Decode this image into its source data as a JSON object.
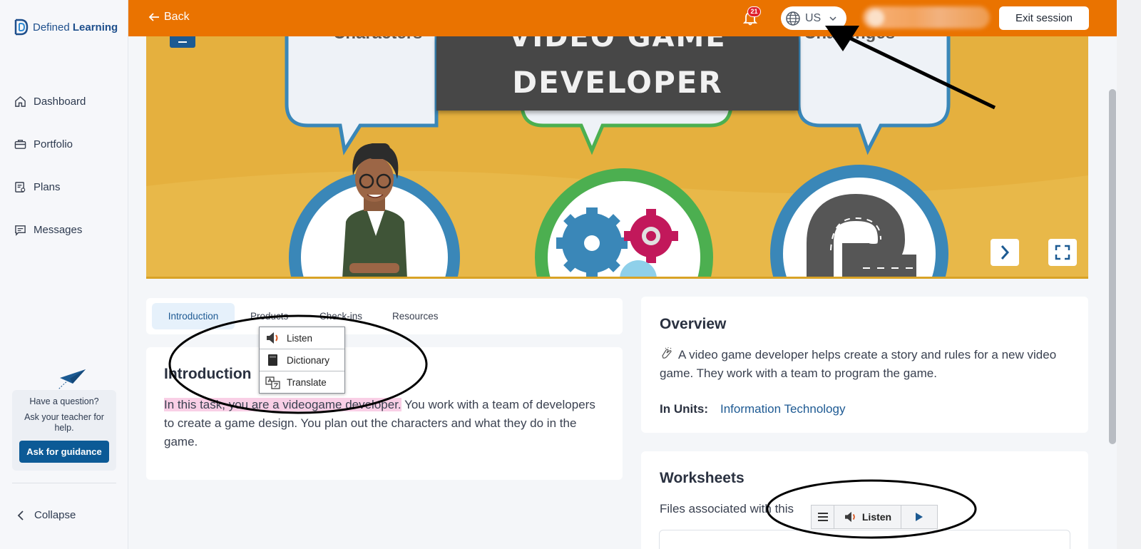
{
  "sidebar": {
    "logo": {
      "part1": "Defined ",
      "part2": "Learning"
    },
    "items": [
      {
        "label": "Dashboard",
        "icon": "home-icon"
      },
      {
        "label": "Portfolio",
        "icon": "briefcase-icon"
      },
      {
        "label": "Plans",
        "icon": "plans-icon"
      },
      {
        "label": "Messages",
        "icon": "message-icon"
      }
    ],
    "help": {
      "question": "Have a question?",
      "text": "Ask your teacher for help.",
      "button": "Ask for guidance"
    },
    "collapse_label": "Collapse"
  },
  "topbar": {
    "back_label": "Back",
    "notification_count": "21",
    "language": "US",
    "exit_label": "Exit session",
    "colors": {
      "bar": "#ea7300"
    }
  },
  "banner": {
    "title_line1": "VIDEO GAME",
    "title_line2": "DEVELOPER",
    "bubble_left": "Characters",
    "bubble_right": "Challenges"
  },
  "tabs": [
    {
      "label": "Introduction",
      "active": true
    },
    {
      "label": "Products",
      "active": false
    },
    {
      "label": "Check-ins",
      "active": false
    },
    {
      "label": "Resources",
      "active": false
    }
  ],
  "popup": {
    "items": [
      {
        "label": "Listen",
        "icon": "speaker-icon"
      },
      {
        "label": "Dictionary",
        "icon": "book-icon"
      },
      {
        "label": "Translate",
        "icon": "translate-icon"
      }
    ]
  },
  "intro": {
    "title": "Introduction",
    "highlighted": "In this task, you are a videogame developer.",
    "rest": " You work with a team of developers to create a game design. You plan out the characters and what they do in the game."
  },
  "overview": {
    "title": "Overview",
    "text": "A video game developer helps create a story and rules for a new video game. They work with a team to program the game.",
    "units_label": "In Units:",
    "units_value": "Information Technology"
  },
  "worksheets": {
    "title": "Worksheets",
    "text": "Files associated with this"
  },
  "listen_bar": {
    "label": "Listen"
  }
}
